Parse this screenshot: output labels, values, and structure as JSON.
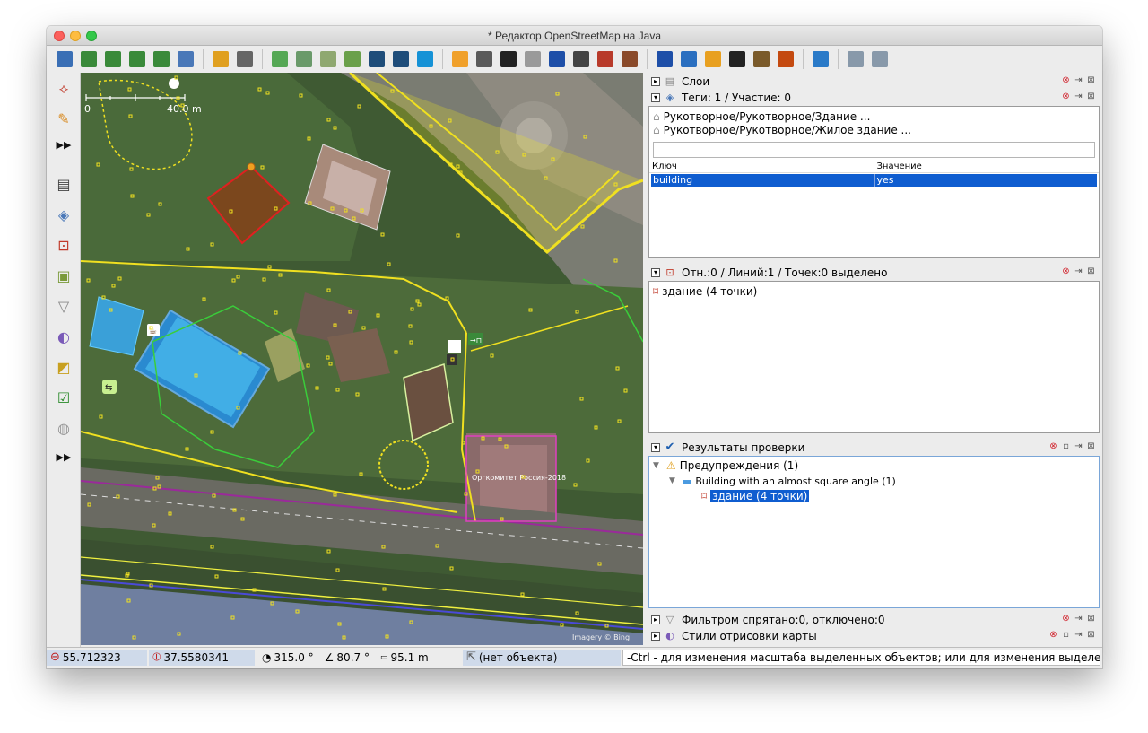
{
  "window": {
    "title": "* Редактор OpenStreetMap на Java"
  },
  "toolbar": {
    "buttons": [
      {
        "name": "open-file-icon",
        "color": "#3a6fb5"
      },
      {
        "name": "save-icon",
        "color": "#3a8a3a"
      },
      {
        "name": "download-icon",
        "color": "#3a8a3a"
      },
      {
        "name": "download-data-icon",
        "color": "#3a8a3a"
      },
      {
        "name": "upload-icon",
        "color": "#3a8a3a"
      },
      {
        "name": "world-icon",
        "color": "#4a78b8"
      },
      {
        "name": "undo-icon",
        "color": "#e0a020"
      },
      {
        "name": "redo-icon",
        "color": "#666666"
      },
      {
        "name": "zoom-to-fit-icon",
        "color": "#55a855"
      },
      {
        "name": "preferences-icon",
        "color": "#6a9a6a"
      },
      {
        "name": "wms-tms-icon",
        "color": "#8fa870"
      },
      {
        "name": "search-icon",
        "color": "#6aa04a"
      },
      {
        "name": "oneway-icon",
        "color": "#1f4d7a"
      },
      {
        "name": "oneway-reverse-icon",
        "color": "#1f4d7a"
      },
      {
        "name": "bing-icon",
        "color": "#1692d6"
      },
      {
        "name": "road-yellow-icon",
        "color": "#f0a02a"
      },
      {
        "name": "road-grey-icon",
        "color": "#5a5a5a"
      },
      {
        "name": "road-black-icon",
        "color": "#222222"
      },
      {
        "name": "road-grey2-icon",
        "color": "#9a9a9a"
      },
      {
        "name": "parking-icon",
        "color": "#1e4fa8"
      },
      {
        "name": "traffic-light-icon",
        "color": "#444444"
      },
      {
        "name": "wall-icon",
        "color": "#b83a2a"
      },
      {
        "name": "railway-icon",
        "color": "#8a4a2a"
      },
      {
        "name": "info-icon",
        "color": "#1e4fa8"
      },
      {
        "name": "bed-icon",
        "color": "#2a6fc0"
      },
      {
        "name": "shop-bag-icon",
        "color": "#e8a020"
      },
      {
        "name": "football-icon",
        "color": "#222222"
      },
      {
        "name": "factory-icon",
        "color": "#7a5a2a"
      },
      {
        "name": "peak-icon",
        "color": "#c44a10"
      },
      {
        "name": "waterway-icon",
        "color": "#2a7ac8"
      },
      {
        "name": "zoom-in-icon",
        "color": "#8899aa"
      },
      {
        "name": "zoom-out-icon",
        "color": "#8899aa"
      }
    ]
  },
  "map": {
    "scale_start": "0",
    "scale_end": "40.0 m",
    "building_label": "Оргкомитет Россия-2018",
    "attribution": "Imagery © Bing"
  },
  "panels": {
    "layers": {
      "title": "Слои"
    },
    "tags": {
      "title": "Теги: 1 / Участие: 0",
      "presets": [
        "Рукотворное/Рукотворное/Здание ...",
        "Рукотворное/Рукотворное/Жилое здание ..."
      ],
      "search_value": "",
      "col_key": "Ключ",
      "col_value": "Значение",
      "rows": [
        {
          "key": "building",
          "value": "yes"
        }
      ]
    },
    "selection": {
      "title": "Отн.:0 / Линий:1 / Точек:0 выделено",
      "items": [
        "здание (4 точки)"
      ]
    },
    "validation": {
      "title": "Результаты проверки",
      "warnings": "Предупреждения (1)",
      "group": "Building with an almost square angle (1)",
      "item": "здание (4 точки)"
    },
    "filter": {
      "title": "Фильтром спрятано:0, отключено:0"
    },
    "styles": {
      "title": "Стили отрисовки карты"
    }
  },
  "status": {
    "lat": "55.712323",
    "lon": "37.5580341",
    "heading": "315.0 °",
    "angle": "80.7 °",
    "distance": "95.1 m",
    "object": "(нет объекта)",
    "help": "-Ctrl - для изменения масштаба выделенных объектов; или для изменения выделения"
  }
}
